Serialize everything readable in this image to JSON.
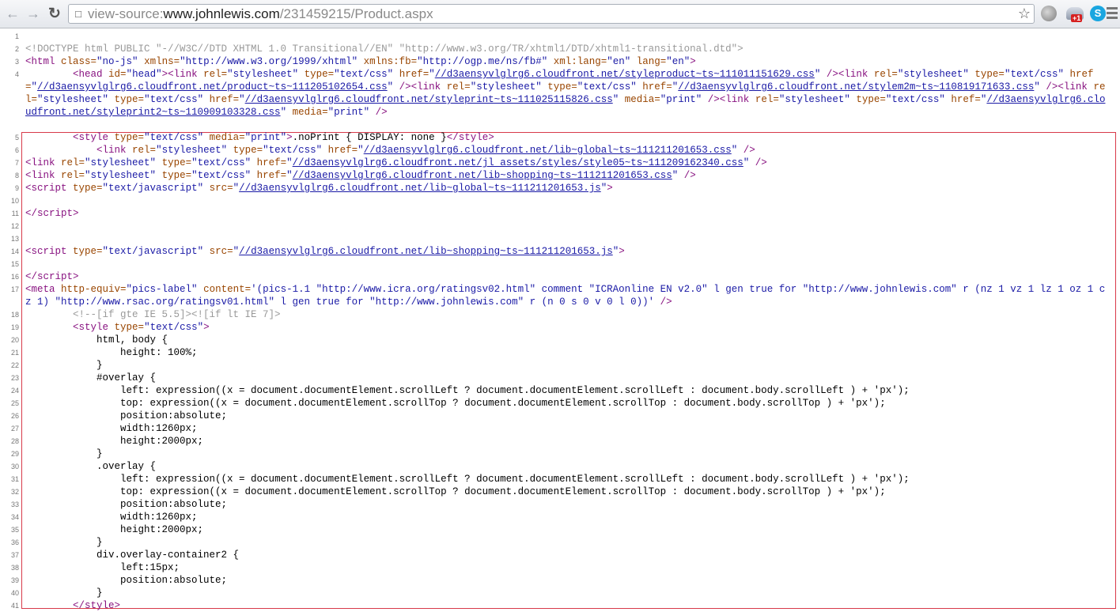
{
  "browser": {
    "url_prefix": "view-source:",
    "url_host": "www.johnlewis.com",
    "url_path": "/231459215/Product.aspx",
    "extension_badge": "+1",
    "skype_glyph": "S"
  },
  "source_lines": [
    {
      "num": "1",
      "html": ""
    },
    {
      "num": "2",
      "html": "<span class=\"cm\">&lt;!DOCTYPE html PUBLIC \"-//W3C//DTD XHTML 1.0 Transitional//EN\" \"http://www.w3.org/TR/xhtml1/DTD/xhtml1-transitional.dtd\"&gt;</span>"
    },
    {
      "num": "3",
      "html": "<span class=\"t\">&lt;html</span> <span class=\"a\">class=</span><span class=\"v\">\"no-js\"</span> <span class=\"a\">xmlns=</span><span class=\"v\">\"http://www.w3.org/1999/xhtml\"</span> <span class=\"a\">xmlns:fb=</span><span class=\"v\">\"http://ogp.me/ns/fb#\"</span> <span class=\"a\">xml:lang=</span><span class=\"v\">\"en\"</span> <span class=\"a\">lang=</span><span class=\"v\">\"en\"</span><span class=\"t\">&gt;</span>"
    },
    {
      "num": "4",
      "html": "        <span class=\"t\">&lt;head</span> <span class=\"a\">id=</span><span class=\"v\">\"head\"</span><span class=\"t\">&gt;&lt;link</span> <span class=\"a\">rel=</span><span class=\"v\">\"stylesheet\"</span> <span class=\"a\">type=</span><span class=\"v\">\"text/css\"</span> <span class=\"a\">href=</span><span class=\"v\">\"<a>//d3aensyvlglrg6.cloudfront.net/styleproduct~ts~111011151629.css</a>\"</span> <span class=\"t\">/&gt;&lt;link</span> <span class=\"a\">rel=</span><span class=\"v\">\"stylesheet\"</span> <span class=\"a\">type=</span><span class=\"v\">\"text/css\"</span> <span class=\"a\">href=</span><span class=\"v\">\"<a>//d3aensyvlglrg6.cloudfront.net/product~ts~111205102654.css</a>\"</span> <span class=\"t\">/&gt;&lt;link</span> <span class=\"a\">rel=</span><span class=\"v\">\"stylesheet\"</span> <span class=\"a\">type=</span><span class=\"v\">\"text/css\"</span> <span class=\"a\">href=</span><span class=\"v\">\"<a>//d3aensyvlglrg6.cloudfront.net/stylem2m~ts~110819171633.css</a>\"</span> <span class=\"t\">/&gt;&lt;link</span> <span class=\"a\">rel=</span><span class=\"v\">\"stylesheet\"</span> <span class=\"a\">type=</span><span class=\"v\">\"text/css\"</span> <span class=\"a\">href=</span><span class=\"v\">\"<a>//d3aensyvlglrg6.cloudfront.net/styleprint~ts~111025115826.css</a>\"</span> <span class=\"a\">media=</span><span class=\"v\">\"print\"</span> <span class=\"t\">/&gt;&lt;link</span> <span class=\"a\">rel=</span><span class=\"v\">\"stylesheet\"</span> <span class=\"a\">type=</span><span class=\"v\">\"text/css\"</span> <span class=\"a\">href=</span><span class=\"v\">\"<a>//d3aensyvlglrg6.cloudfront.net/styleprint2~ts~110909103328.css</a>\"</span> <span class=\"a\">media=</span><span class=\"v\">\"print\"</span> <span class=\"t\">/&gt;</span>"
    },
    {
      "num": "5",
      "html": "        <span class=\"t\">&lt;style</span> <span class=\"a\">type=</span><span class=\"v\">\"text/css\"</span> <span class=\"a\">media=</span><span class=\"v\">\"print\"</span><span class=\"t\">&gt;</span>.noPrint { DISPLAY: none }<span class=\"t\">&lt;/style&gt;</span>"
    },
    {
      "num": "6",
      "html": "            <span class=\"t\">&lt;link</span> <span class=\"a\">rel=</span><span class=\"v\">\"stylesheet\"</span> <span class=\"a\">type=</span><span class=\"v\">\"text/css\"</span> <span class=\"a\">href=</span><span class=\"v\">\"<a>//d3aensyvlglrg6.cloudfront.net/lib~global~ts~111211201653.css</a>\"</span> <span class=\"t\">/&gt;</span>"
    },
    {
      "num": "7",
      "html": "<span class=\"t\">&lt;link</span> <span class=\"a\">rel=</span><span class=\"v\">\"stylesheet\"</span> <span class=\"a\">type=</span><span class=\"v\">\"text/css\"</span> <span class=\"a\">href=</span><span class=\"v\">\"<a>//d3aensyvlglrg6.cloudfront.net/jl_assets/styles/style05~ts~111209162340.css</a>\"</span> <span class=\"t\">/&gt;</span>"
    },
    {
      "num": "8",
      "html": "<span class=\"t\">&lt;link</span> <span class=\"a\">rel=</span><span class=\"v\">\"stylesheet\"</span> <span class=\"a\">type=</span><span class=\"v\">\"text/css\"</span> <span class=\"a\">href=</span><span class=\"v\">\"<a>//d3aensyvlglrg6.cloudfront.net/lib~shopping~ts~111211201653.css</a>\"</span> <span class=\"t\">/&gt;</span>"
    },
    {
      "num": "9",
      "html": "<span class=\"t\">&lt;script</span> <span class=\"a\">type=</span><span class=\"v\">\"text/javascript\"</span> <span class=\"a\">src=</span><span class=\"v\">\"<a>//d3aensyvlglrg6.cloudfront.net/lib~global~ts~111211201653.js</a>\"</span><span class=\"t\">&gt;</span>"
    },
    {
      "num": "10",
      "html": ""
    },
    {
      "num": "11",
      "html": "<span class=\"t\">&lt;/script&gt;</span>"
    },
    {
      "num": "12",
      "html": ""
    },
    {
      "num": "13",
      "html": ""
    },
    {
      "num": "14",
      "html": "<span class=\"t\">&lt;script</span> <span class=\"a\">type=</span><span class=\"v\">\"text/javascript\"</span> <span class=\"a\">src=</span><span class=\"v\">\"<a>//d3aensyvlglrg6.cloudfront.net/lib~shopping~ts~111211201653.js</a>\"</span><span class=\"t\">&gt;</span>"
    },
    {
      "num": "15",
      "html": ""
    },
    {
      "num": "16",
      "html": "<span class=\"t\">&lt;/script&gt;</span>"
    },
    {
      "num": "17",
      "html": "<span class=\"t\">&lt;meta</span> <span class=\"a\">http-equiv=</span><span class=\"v\">\"pics-label\"</span> <span class=\"a\">content=</span><span class=\"v\">'(pics-1.1 \"http://www.icra.org/ratingsv02.html\" comment \"ICRAonline EN v2.0\" l gen true for \"http://www.johnlewis.com\" r (nz 1 vz 1 lz 1 oz 1 cz 1) \"http://www.rsac.org/ratingsv01.html\" l gen true for \"http://www.johnlewis.com\" r (n 0 s 0 v 0 l 0))'</span> <span class=\"t\">/&gt;</span>"
    },
    {
      "num": "18",
      "html": "        <span class=\"cm\">&lt;!--[if gte IE 5.5]&gt;&lt;![if lt IE 7]&gt;</span>"
    },
    {
      "num": "19",
      "html": "        <span class=\"t\">&lt;style</span> <span class=\"a\">type=</span><span class=\"v\">\"text/css\"</span><span class=\"t\">&gt;</span>"
    },
    {
      "num": "20",
      "html": "            html, body {"
    },
    {
      "num": "21",
      "html": "                height: 100%;"
    },
    {
      "num": "22",
      "html": "            }"
    },
    {
      "num": "23",
      "html": "            #overlay {"
    },
    {
      "num": "24",
      "html": "                left: expression((x = document.documentElement.scrollLeft ? document.documentElement.scrollLeft : document.body.scrollLeft ) + 'px');"
    },
    {
      "num": "25",
      "html": "                top: expression((x = document.documentElement.scrollTop ? document.documentElement.scrollTop : document.body.scrollTop ) + 'px');"
    },
    {
      "num": "26",
      "html": "                position:absolute;"
    },
    {
      "num": "27",
      "html": "                width:1260px;"
    },
    {
      "num": "28",
      "html": "                height:2000px;"
    },
    {
      "num": "29",
      "html": "            }"
    },
    {
      "num": "30",
      "html": "            .overlay {"
    },
    {
      "num": "31",
      "html": "                left: expression((x = document.documentElement.scrollLeft ? document.documentElement.scrollLeft : document.body.scrollLeft ) + 'px');"
    },
    {
      "num": "32",
      "html": "                top: expression((x = document.documentElement.scrollTop ? document.documentElement.scrollTop : document.body.scrollTop ) + 'px');"
    },
    {
      "num": "33",
      "html": "                position:absolute;"
    },
    {
      "num": "34",
      "html": "                width:1260px;"
    },
    {
      "num": "35",
      "html": "                height:2000px;"
    },
    {
      "num": "36",
      "html": "            }"
    },
    {
      "num": "37",
      "html": "            div.overlay-container2 {"
    },
    {
      "num": "38",
      "html": "                left:15px;"
    },
    {
      "num": "39",
      "html": "                position:absolute;"
    },
    {
      "num": "40",
      "html": "            }"
    },
    {
      "num": "41",
      "html": "        <span class=\"t\">&lt;/style&gt;</span>"
    }
  ]
}
